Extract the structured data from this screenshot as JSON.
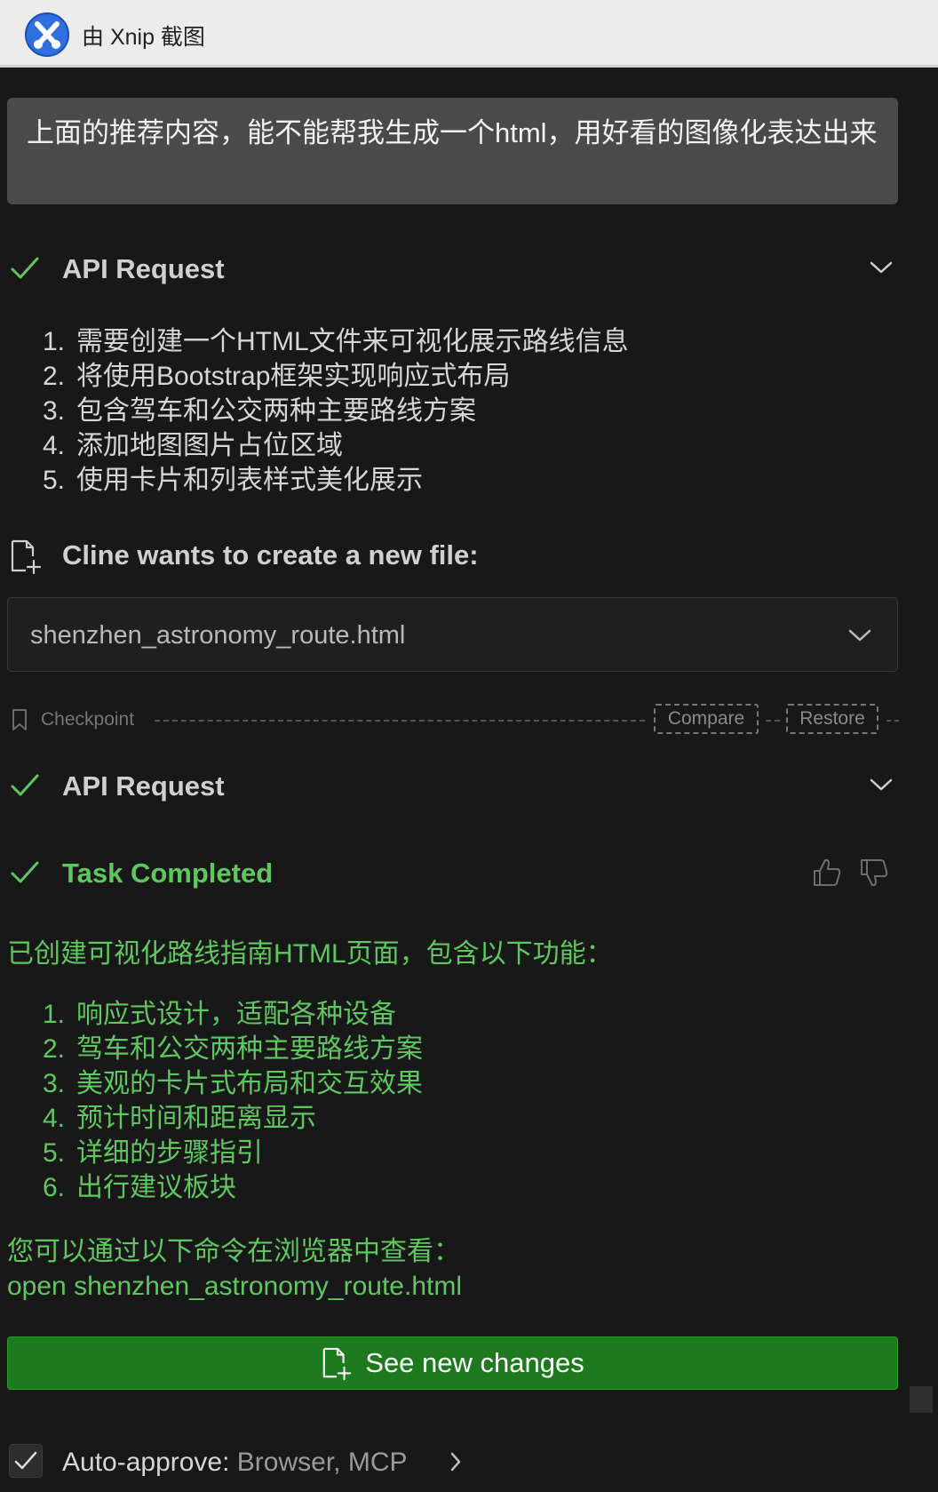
{
  "app": {
    "title": "由 Xnip 截图"
  },
  "user_message": {
    "text": "上面的推荐内容，能不能帮我生成一个html，用好看的图像化表达出来"
  },
  "api_request_1": {
    "label": "API Request",
    "steps": [
      {
        "num": "1.",
        "text": "需要创建一个HTML文件来可视化展示路线信息"
      },
      {
        "num": "2.",
        "text": "将使用Bootstrap框架实现响应式布局"
      },
      {
        "num": "3.",
        "text": "包含驾车和公交两种主要路线方案"
      },
      {
        "num": "4.",
        "text": "添加地图图片占位区域"
      },
      {
        "num": "5.",
        "text": "使用卡片和列表样式美化展示"
      }
    ]
  },
  "new_file": {
    "label": "Cline wants to create a new file:",
    "filename": "shenzhen_astronomy_route.html"
  },
  "checkpoint": {
    "label": "Checkpoint",
    "compare": "Compare",
    "restore": "Restore"
  },
  "api_request_2": {
    "label": "API Request"
  },
  "task": {
    "label": "Task Completed",
    "summary": "已创建可视化路线指南HTML页面，包含以下功能：",
    "features": [
      {
        "num": "1.",
        "text": "响应式设计，适配各种设备"
      },
      {
        "num": "2.",
        "text": "驾车和公交两种主要路线方案"
      },
      {
        "num": "3.",
        "text": "美观的卡片式布局和交互效果"
      },
      {
        "num": "4.",
        "text": "预计时间和距离显示"
      },
      {
        "num": "5.",
        "text": "详细的步骤指引"
      },
      {
        "num": "6.",
        "text": "出行建议板块"
      }
    ],
    "view_hint": "您可以通过以下命令在浏览器中查看：",
    "command": "open shenzhen_astronomy_route.html"
  },
  "cta": {
    "label": "See new changes"
  },
  "auto_approve": {
    "label": "Auto-approve:",
    "value": "Browser, MCP"
  },
  "colors": {
    "accent_green": "#5fc760",
    "button_green": "#1e7a1e",
    "background": "#181818"
  }
}
